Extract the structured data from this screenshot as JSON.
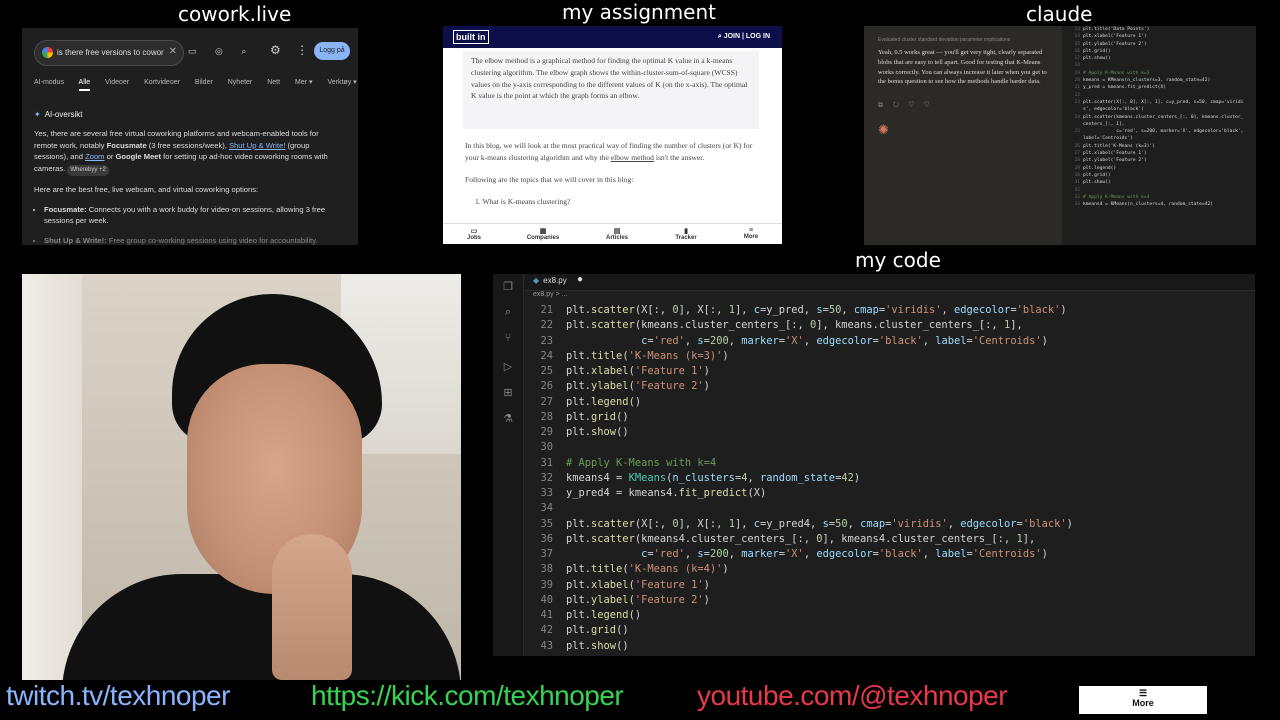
{
  "labels": {
    "cowork": "cowork.live",
    "assignment": "my assignment",
    "claude": "claude",
    "code": "my code"
  },
  "google": {
    "query": "is there free versions to cowor",
    "login": "Logg på",
    "tabs": [
      "AI-modus",
      "Alle",
      "Videoer",
      "Kortvideoer",
      "Bilder",
      "Nyheter",
      "Nett",
      "Mer ▾",
      "Verktøy ▾"
    ],
    "ai_title": "AI-oversikt",
    "p1_a": "Yes, there are several free virtual coworking platforms and webcam-enabled tools for remote work, notably ",
    "p1_b": "Focusmate",
    "p1_c": " (3 free sessions/week), ",
    "p1_d": "Shut Up & Write!",
    "p1_e": " (group sessions), and ",
    "p1_f": "Zoom",
    "p1_g": " or ",
    "p1_h": "Google Meet",
    "p1_i": " for setting up ad-hoc video coworking rooms with cameras.",
    "chip": "Wherebyy +2",
    "p2": "Here are the best free, live webcam, and virtual coworking options:",
    "li1_b": "Focusmate:",
    "li1": " Connects you with a work buddy for video-on sessions, allowing 3 free sessions per week.",
    "li2_b": "Shut Up & Write!:",
    "li2": " Free group co-working sessions using video for accountability."
  },
  "builtin": {
    "logo": "built in",
    "nav": "JOIN | LOG IN",
    "box": "The elbow method is a graphical method for finding the optimal K value in a k-means clustering algorithm. The elbow graph shows the within-cluster-sum-of-square (WCSS) values on the y-axis corresponding to the different values of K (on the x-axis). The optimal K value is the point at which the graph forms an elbow.",
    "p1_a": "In this blog, we will look at the most practical way of finding the number of clusters (or K) for your k-means clustering algorithm and why the ",
    "p1_link": "elbow method",
    "p1_b": " isn't the answer.",
    "p2": "Following are the topics that we will cover in this blog:",
    "li1": "1. What is K-means clustering?",
    "bar": [
      "Jobs",
      "Companies",
      "Articles",
      "Tracker",
      "More"
    ]
  },
  "claude": {
    "thread": "Evaluated cluster standard deviation parameter implications",
    "msg": "Yeah, 0.5 works great — you'll get very tight, clearly separated blobs that are easy to tell apart. Good for testing that K-Means works correctly. You can always increase it later when you get to the bonus question to see how the methods handle harder data.",
    "code": [
      [
        "13",
        "plt.title('Data Points')"
      ],
      [
        "14",
        "plt.xlabel('Feature 1')"
      ],
      [
        "15",
        "plt.ylabel('Feature 2')"
      ],
      [
        "16",
        "plt.grid()"
      ],
      [
        "17",
        "plt.show()"
      ],
      [
        "18",
        ""
      ],
      [
        "19",
        "# Apply K-Means with k=3"
      ],
      [
        "20",
        "kmeans = KMeans(n_clusters=3, random_state=42)"
      ],
      [
        "21",
        "y_pred = kmeans.fit_predict(X)"
      ],
      [
        "22",
        ""
      ],
      [
        "23",
        "plt.scatter(X[:, 0], X[:, 1], c=y_pred, s=50, cmap='viridi"
      ],
      [
        "",
        "s', edgecolor='black')"
      ],
      [
        "24",
        "plt.scatter(kmeans.cluster_centers_[:, 0], kmeans.cluster_"
      ],
      [
        "",
        "centers_[:, 1],"
      ],
      [
        "25",
        "            c='red', s=200, marker='X', edgecolor='black',"
      ],
      [
        "",
        "label='Centroids')"
      ],
      [
        "26",
        "plt.title('K-Means (k=3)')"
      ],
      [
        "27",
        "plt.xlabel('Feature 1')"
      ],
      [
        "28",
        "plt.ylabel('Feature 2')"
      ],
      [
        "29",
        "plt.legend()"
      ],
      [
        "30",
        "plt.grid()"
      ],
      [
        "31",
        "plt.show()"
      ],
      [
        "32",
        ""
      ],
      [
        "33",
        "# Apply K-Means with k=4"
      ],
      [
        "34",
        "kmeans4 = KMeans(n_clusters=4, random_state=42)"
      ]
    ]
  },
  "vscode": {
    "tab": "ex8.py",
    "crumb": "ex8.py > ...",
    "lines": [
      {
        "n": "21",
        "t": "plt.scatter(X[:, 0], X[:, 1], c=y_pred, s=50, cmap='viridis', edgecolor='black')"
      },
      {
        "n": "22",
        "t": "plt.scatter(kmeans.cluster_centers_[:, 0], kmeans.cluster_centers_[:, 1],"
      },
      {
        "n": "23",
        "t": "            c='red', s=200, marker='X', edgecolor='black', label='Centroids')"
      },
      {
        "n": "24",
        "t": "plt.title('K-Means (k=3)')"
      },
      {
        "n": "25",
        "t": "plt.xlabel('Feature 1')"
      },
      {
        "n": "26",
        "t": "plt.ylabel('Feature 2')"
      },
      {
        "n": "27",
        "t": "plt.legend()"
      },
      {
        "n": "28",
        "t": "plt.grid()"
      },
      {
        "n": "29",
        "t": "plt.show()"
      },
      {
        "n": "30",
        "t": ""
      },
      {
        "n": "31",
        "t": "# Apply K-Means with k=4"
      },
      {
        "n": "32",
        "t": "kmeans4 = KMeans(n_clusters=4, random_state=42)"
      },
      {
        "n": "33",
        "t": "y_pred4 = kmeans4.fit_predict(X)"
      },
      {
        "n": "34",
        "t": ""
      },
      {
        "n": "35",
        "t": "plt.scatter(X[:, 0], X[:, 1], c=y_pred4, s=50, cmap='viridis', edgecolor='black')"
      },
      {
        "n": "36",
        "t": "plt.scatter(kmeans4.cluster_centers_[:, 0], kmeans4.cluster_centers_[:, 1],"
      },
      {
        "n": "37",
        "t": "            c='red', s=200, marker='X', edgecolor='black', label='Centroids')"
      },
      {
        "n": "38",
        "t": "plt.title('K-Means (k=4)')"
      },
      {
        "n": "39",
        "t": "plt.xlabel('Feature 1')"
      },
      {
        "n": "40",
        "t": "plt.ylabel('Feature 2')"
      },
      {
        "n": "41",
        "t": "plt.legend()"
      },
      {
        "n": "42",
        "t": "plt.grid()"
      },
      {
        "n": "43",
        "t": "plt.show()"
      }
    ]
  },
  "footer": {
    "twitch": "twitch.tv/texhnoper",
    "kick": "https://kick.com/texhnoper",
    "youtube": "youtube.com/@texhnoper",
    "more": "More"
  },
  "colors": {
    "twitch": "#8ab4ff",
    "kick": "#39d353",
    "youtube": "#e8394a"
  }
}
